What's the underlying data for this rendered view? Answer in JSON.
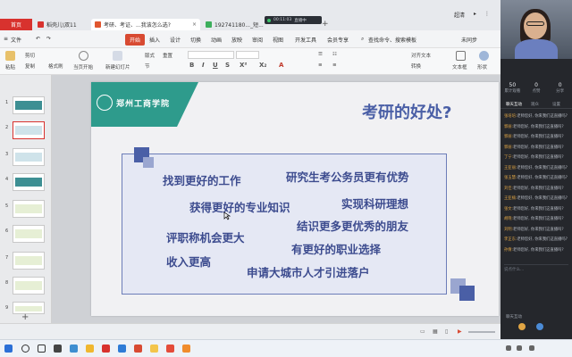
{
  "tabs": {
    "home": "首页",
    "t1": "稻壳儿\\双11",
    "t2": "考研、考证、...我该怎么选?",
    "t3": "192741180..._短... "
  },
  "recording": {
    "time": "00:11:03",
    "label": "直播中"
  },
  "topright": {
    "quality": "超清"
  },
  "menu": {
    "file": "文件",
    "start": "开始",
    "insert": "插入",
    "design": "设计",
    "switch": "切换",
    "animation": "动画",
    "show": "放映",
    "review": "审阅",
    "view": "视图",
    "dev": "开发工具",
    "member": "会员专享",
    "search": "查找命令、搜索模板",
    "sync": "未同步"
  },
  "toolbar": {
    "paste": "粘贴",
    "cut": "剪切",
    "copy": "复制",
    "format_painter": "格式刷",
    "from_current": "当页开始",
    "new_slide": "新建幻灯片",
    "layout": "版式",
    "section": "节",
    "reset": "重置",
    "align_text": "对齐文本",
    "convert": "转换",
    "textbox": "文本框",
    "shape": "形状"
  },
  "thumb_numbers": [
    "1",
    "2",
    "3",
    "4",
    "5",
    "6",
    "7",
    "8",
    "9"
  ],
  "slide": {
    "logo_text": "郑州工商学院",
    "title": "考研的好处?",
    "phrases": [
      "找到更好的工作",
      "研究生考公务员更有优势",
      "获得更好的专业知识",
      "实现科研理想",
      "结识更多更优秀的朋友",
      "评职称机会更大",
      "有更好的职业选择",
      "收入更高",
      "申请大城市人才引进落户"
    ]
  },
  "panel": {
    "stats": [
      {
        "value": "50",
        "label": "累计观看"
      },
      {
        "value": "0",
        "label": "点赞"
      },
      {
        "value": "0",
        "label": "分享"
      }
    ],
    "tabs": [
      "聊天互动",
      "观众",
      "设置"
    ],
    "messages": [
      {
        "user": "张培培:",
        "text": "老师您好, 你来我们这直播吗?"
      },
      {
        "user": "郭丽:",
        "text": "老师您好, 你来我们这直播吗?"
      },
      {
        "user": "郭丽:",
        "text": "老师您好, 你来我们这直播吗?"
      },
      {
        "user": "郭丽:",
        "text": "老师您好, 你来我们这直播吗?"
      },
      {
        "user": "丁宁:",
        "text": "老师您好, 你来我们这直播吗?"
      },
      {
        "user": "王亚丽:",
        "text": "老师您好, 你来我们这直播吗?"
      },
      {
        "user": "张玉慧:",
        "text": "老师您好, 你来我们这直播吗?"
      },
      {
        "user": "刘佳:",
        "text": "老师您好, 你来我们这直播吗?"
      },
      {
        "user": "王亚楠:",
        "text": "老师您好, 你来我们这直播吗?"
      },
      {
        "user": "张文:",
        "text": "老师您好, 你来我们这直播吗?"
      },
      {
        "user": "胡晓:",
        "text": "老师您好, 你来我们这直播吗?"
      },
      {
        "user": "刘明:",
        "text": "老师您好, 你来我们这直播吗?"
      },
      {
        "user": "李正东:",
        "text": "老师您好, 你来我们这直播吗?"
      },
      {
        "user": "孙倩:",
        "text": "老师您好, 你来我们这直播吗?"
      }
    ],
    "chat_placeholder": "说点什么...",
    "bottom_label": "聊天互动"
  },
  "colors": {
    "accent_red": "#d8322e",
    "slide_teal": "#2e9b8c",
    "slide_blue": "#3d4c8f",
    "sq_dark": "#4a5fa6",
    "sq_light": "#9aa6d0"
  }
}
